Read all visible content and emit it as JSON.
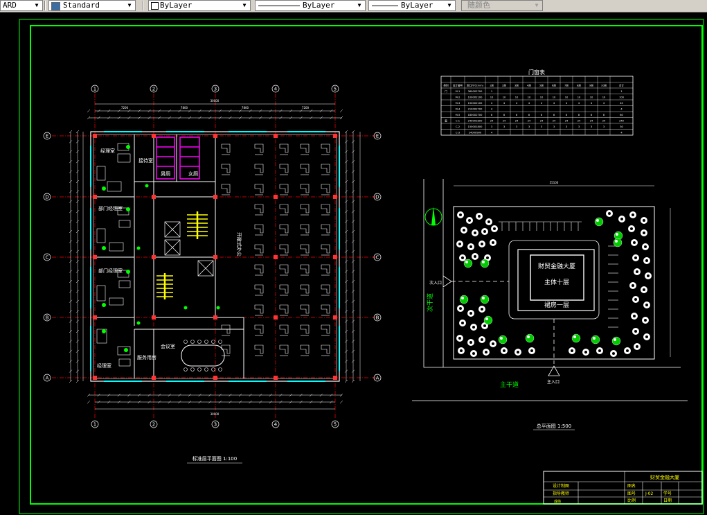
{
  "toolbar": {
    "text_style_partial": "ARD",
    "text_style": "Standard",
    "layer": "ByLayer",
    "linetype": "ByLayer",
    "lineweight": "ByLayer",
    "plot_style": "随颜色"
  },
  "floor_plan": {
    "title": "标准层平面图 1:100",
    "rooms": {
      "r1": "经理室",
      "r2": "接待室",
      "r3": "部门经理室",
      "r4": "部门经理室",
      "r5": "经理室",
      "r6": "男厕",
      "r7": "女厕",
      "r8": "会议室",
      "r9": "服务用房",
      "open_office": "开敞式办公"
    },
    "axis_top": [
      "1",
      "2",
      "3",
      "4",
      "5"
    ],
    "axis_left": [
      "E",
      "D",
      "C",
      "B",
      "A"
    ],
    "top_total_dim": "30000",
    "bottom_total_dim": "30000",
    "top_sub_dims": [
      "7200",
      "7800",
      "7800",
      "7200"
    ]
  },
  "door_table": {
    "title": "门窗表",
    "header": [
      "类别",
      "设计编号",
      "洞口尺寸(mm)",
      "1层",
      "2层",
      "3层",
      "4层",
      "5层",
      "6层",
      "7层",
      "8层",
      "9层",
      "10层",
      "合计"
    ],
    "rows": [
      [
        "门",
        "M-1",
        "3600X2700",
        "1",
        "",
        "",
        "",
        "",
        "",
        "",
        "",
        "",
        "",
        "1"
      ],
      [
        "",
        "M-2",
        "1000X2100",
        "10",
        "10",
        "10",
        "10",
        "10",
        "10",
        "10",
        "10",
        "10",
        "10",
        "100"
      ],
      [
        "",
        "M-3",
        "1500X2100",
        "4",
        "4",
        "4",
        "4",
        "4",
        "4",
        "4",
        "4",
        "4",
        "4",
        "40"
      ],
      [
        "",
        "M-4",
        "2100X2700",
        "4",
        "",
        "",
        "",
        "",
        "",
        "",
        "",
        "",
        "",
        "4"
      ],
      [
        "",
        "M-5",
        "1800X2700",
        "8",
        "8",
        "8",
        "8",
        "8",
        "8",
        "8",
        "8",
        "8",
        "8",
        "80"
      ],
      [
        "窗",
        "C-1",
        "2400X1800",
        "24",
        "24",
        "24",
        "24",
        "24",
        "24",
        "24",
        "24",
        "24",
        "24",
        "240"
      ],
      [
        "",
        "C-2",
        "1500X1800",
        "3",
        "3",
        "3",
        "3",
        "3",
        "3",
        "3",
        "3",
        "3",
        "3",
        "30"
      ],
      [
        "",
        "C-3",
        "2400X900",
        "4",
        "",
        "",
        "",
        "",
        "",
        "",
        "",
        "",
        "",
        "4"
      ]
    ]
  },
  "site_plan": {
    "building_name": "财贸金融大厦",
    "main_floors": "主体十层",
    "podium": "裙房一层",
    "road_label": "主干道",
    "side_road": "次干道",
    "main_entrance": "主入口",
    "secondary_entrance": "次入口",
    "title": "总平面图 1:500",
    "top_dim": "55100"
  },
  "title_block": {
    "project": "财贸金融大厦",
    "row_labels": [
      "设计制图",
      "指导教师"
    ],
    "labels": [
      "图名",
      "图号",
      "比例",
      "学号",
      "日期"
    ],
    "drawing_no": "J-02",
    "bottom_left": "成绩"
  },
  "colors": {
    "frame": "#00ff00",
    "grid_axis": "#ff0000",
    "wall": "#ffffff",
    "window": "#00ffff",
    "stair": "#ffff00",
    "toilet": "#ff00ff",
    "tree": "#00ff00",
    "background": "#000000"
  }
}
